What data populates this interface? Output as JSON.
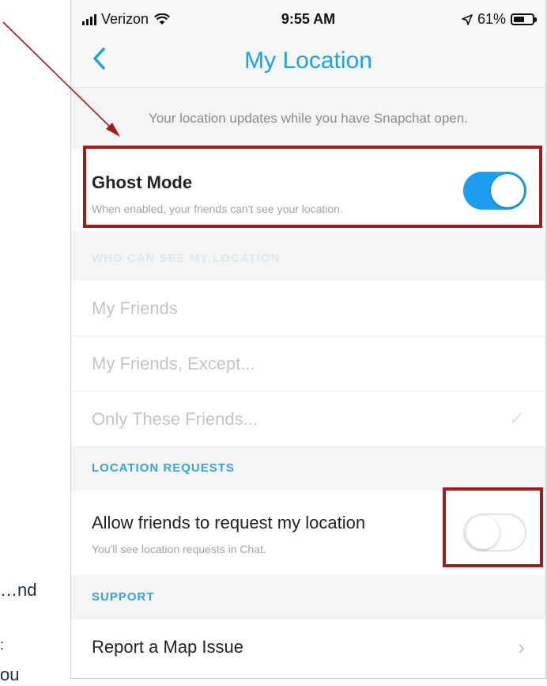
{
  "colors": {
    "accent": "#1aa3e8",
    "highlight": "#a31c1c",
    "toggle_on": "#1d9ef0"
  },
  "fragments": {
    "a": "…nd",
    "b": ":",
    "c": "ou"
  },
  "status_bar": {
    "carrier": "Verizon",
    "time": "9:55 AM",
    "battery": "61%",
    "battery_level": 0.61
  },
  "nav": {
    "back_icon": "chevron-left-icon",
    "title": "My Location"
  },
  "info_text": "Your location updates while you have Snapchat open.",
  "ghost_mode": {
    "title": "Ghost Mode",
    "subtitle": "When enabled, your friends can't see your location.",
    "enabled": true
  },
  "who_can_see": {
    "header": "WHO CAN SEE MY LOCATION",
    "options": [
      {
        "label": "My Friends",
        "checked": false
      },
      {
        "label": "My Friends, Except...",
        "checked": false
      },
      {
        "label": "Only These Friends...",
        "checked": true
      }
    ],
    "check_icon": "✓"
  },
  "location_requests": {
    "header": "LOCATION REQUESTS",
    "title": "Allow friends to request my location",
    "subtitle": "You'll see location requests in Chat.",
    "enabled": false
  },
  "support": {
    "header": "SUPPORT",
    "report_label": "Report a Map Issue",
    "chevron": "›"
  }
}
